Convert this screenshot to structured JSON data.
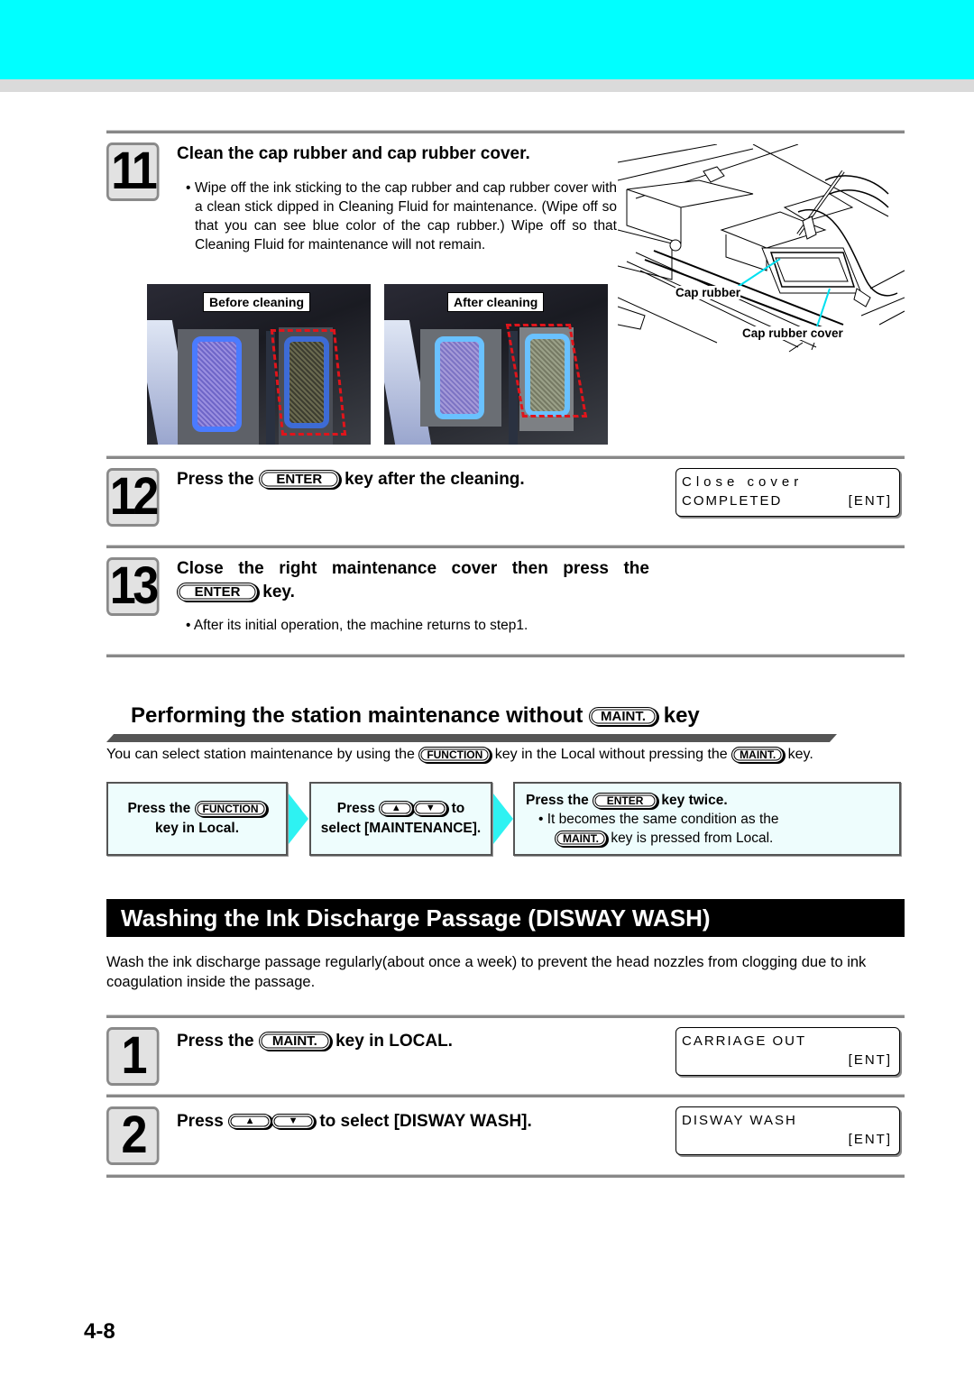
{
  "colors": {
    "header_band": "#00ffff",
    "flow_box_bg": "#eefdfd",
    "flow_arrow": "#2ef2f2",
    "highlight_dash": "#e0141b",
    "banner_bg": "#000000",
    "callout_line": "#00e0f0"
  },
  "steps": {
    "s11": {
      "number": "11",
      "title": "Clean the cap rubber and cap rubber cover.",
      "bullet": "• Wipe off the ink sticking to the cap rubber and cap rubber cover with a clean stick dipped in Cleaning Fluid for maintenance. (Wipe off so that you can see blue color of the cap rubber.) Wipe off so that Cleaning Fluid for maintenance will not remain.",
      "photo_before_label": "Before cleaning",
      "photo_after_label": "After cleaning",
      "diagram_label_cap_rubber": "Cap rubber",
      "diagram_label_cap_rubber_cover": "Cap rubber cover"
    },
    "s12": {
      "number": "12",
      "title_pre": "Press the",
      "key": "ENTER",
      "title_post": "key after the cleaning.",
      "lcd_line1": "Close cover",
      "lcd_line2_left": "COMPLETED",
      "lcd_line2_right": "[ENT]"
    },
    "s13": {
      "number": "13",
      "title_line1": "Close the right maintenance cover then press the",
      "key": "ENTER",
      "title_post": "key.",
      "bullet": "• After its initial operation, the machine returns to step1."
    }
  },
  "station": {
    "heading_pre": "Performing the station maintenance without",
    "heading_key": "MAINT.",
    "heading_post": "key",
    "intro_pre": "You can select station maintenance by using the",
    "intro_key1": "FUNCTION",
    "intro_mid": "key in the Local without pressing the",
    "intro_key2": "MAINT.",
    "intro_post": "key.",
    "flow": [
      {
        "pre": "Press the",
        "key": "FUNCTION",
        "post": "key in Local."
      },
      {
        "pre": "Press",
        "key_up": "▲",
        "key_down": "▼",
        "mid": "to",
        "post": "select [MAINTENANCE]."
      },
      {
        "pre": "Press the",
        "key": "ENTER",
        "post": "key twice.",
        "bullet": "•  It becomes the same condition as the",
        "bullet_key": "MAINT.",
        "bullet_post": "key is pressed from Local."
      }
    ]
  },
  "disway": {
    "banner": "Washing the Ink Discharge Passage (DISWAY WASH)",
    "description": "Wash the ink discharge passage regularly(about once a week) to prevent the head nozzles from clogging due to ink coagulation inside the passage.",
    "steps": [
      {
        "number": "1",
        "pre": "Press the",
        "key": "MAINT.",
        "post": "key in LOCAL.",
        "lcd_line1": "CARRIAGE OUT",
        "lcd_line2": "[ENT]"
      },
      {
        "number": "2",
        "pre": "Press",
        "key_up": "▲",
        "key_down": "▼",
        "post": "to select [DISWAY WASH].",
        "lcd_line1": "DISWAY WASH",
        "lcd_line2": "[ENT]"
      }
    ]
  },
  "page_number": "4-8"
}
